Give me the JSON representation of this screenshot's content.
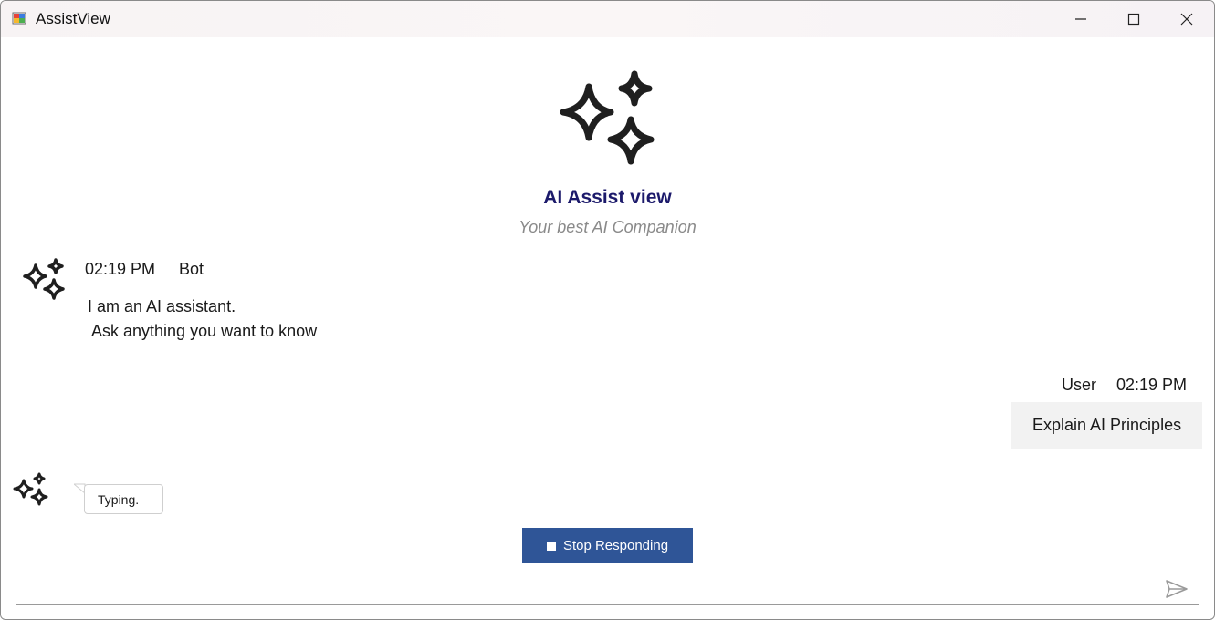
{
  "window": {
    "title": "AssistView",
    "controls": {
      "minimize_icon": "minimize-icon",
      "maximize_icon": "maximize-icon",
      "close_icon": "close-icon"
    }
  },
  "header": {
    "icon": "sparkles-icon",
    "title": "AI Assist view",
    "subtitle": "Your best AI Companion"
  },
  "messages": [
    {
      "author": "Bot",
      "time": "02:19 PM",
      "text": "I am an AI assistant.\n Ask anything you want to know",
      "avatar": "sparkles-icon"
    },
    {
      "author": "User",
      "time": "02:19 PM",
      "text": "Explain AI Principles"
    }
  ],
  "typing": {
    "text": "Typing.",
    "avatar": "sparkles-icon"
  },
  "stop_button": {
    "label": "Stop Responding",
    "icon": "stop-icon",
    "color": "#2f5597"
  },
  "input": {
    "value": "",
    "placeholder": "",
    "send_icon": "send-icon"
  },
  "colors": {
    "title": "#1c1a6b",
    "subtitle": "#8a8a8a",
    "user_bubble": "#f2f2f2"
  }
}
